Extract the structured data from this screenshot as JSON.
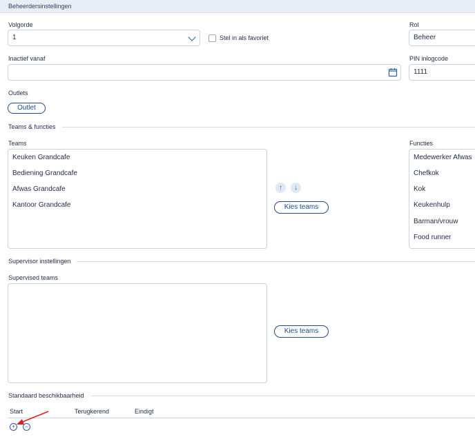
{
  "header": {
    "title": "Beheerdersinstellingen"
  },
  "fields": {
    "volgorde": {
      "label": "Volgorde",
      "value": "1"
    },
    "favoriet": {
      "label": "Stel in als favoriet",
      "checked": false
    },
    "rol": {
      "label": "Rol",
      "value": "Beheer"
    },
    "inactief": {
      "label": "Inactief vanaf",
      "value": ""
    },
    "pin": {
      "label": "PIN inlogcode",
      "value": "1111"
    }
  },
  "outlets": {
    "label": "Outlets",
    "button_label": "Outlet"
  },
  "teams_section": {
    "title": "Teams & functies",
    "teams_label": "Teams",
    "teams": [
      "Keuken Grandcafe",
      "Bediening Grandcafe",
      "Afwas Grandcafe",
      "Kantoor Grandcafe"
    ],
    "up_arrow": "↑",
    "down_arrow": "↓",
    "kies_teams_label": "Kies teams",
    "functies_label": "Functies",
    "functies": [
      "Medewerker Afwas",
      "Chefkok",
      "Kok",
      "Keukenhulp",
      "Barman/vrouw",
      "Food runner"
    ]
  },
  "supervisor": {
    "title": "Supervisor instellingen",
    "supervised_label": "Supervised teams",
    "kies_teams_label": "Kies teams"
  },
  "beschikbaarheid": {
    "title": "Standaard beschikbaarheid",
    "columns": [
      "Start",
      "Terugkerend",
      "Eindigt"
    ],
    "add_symbol": "+",
    "remove_symbol": "−"
  },
  "colors": {
    "accent": "#1f4b8a",
    "annotation_arrow": "#e02020"
  }
}
